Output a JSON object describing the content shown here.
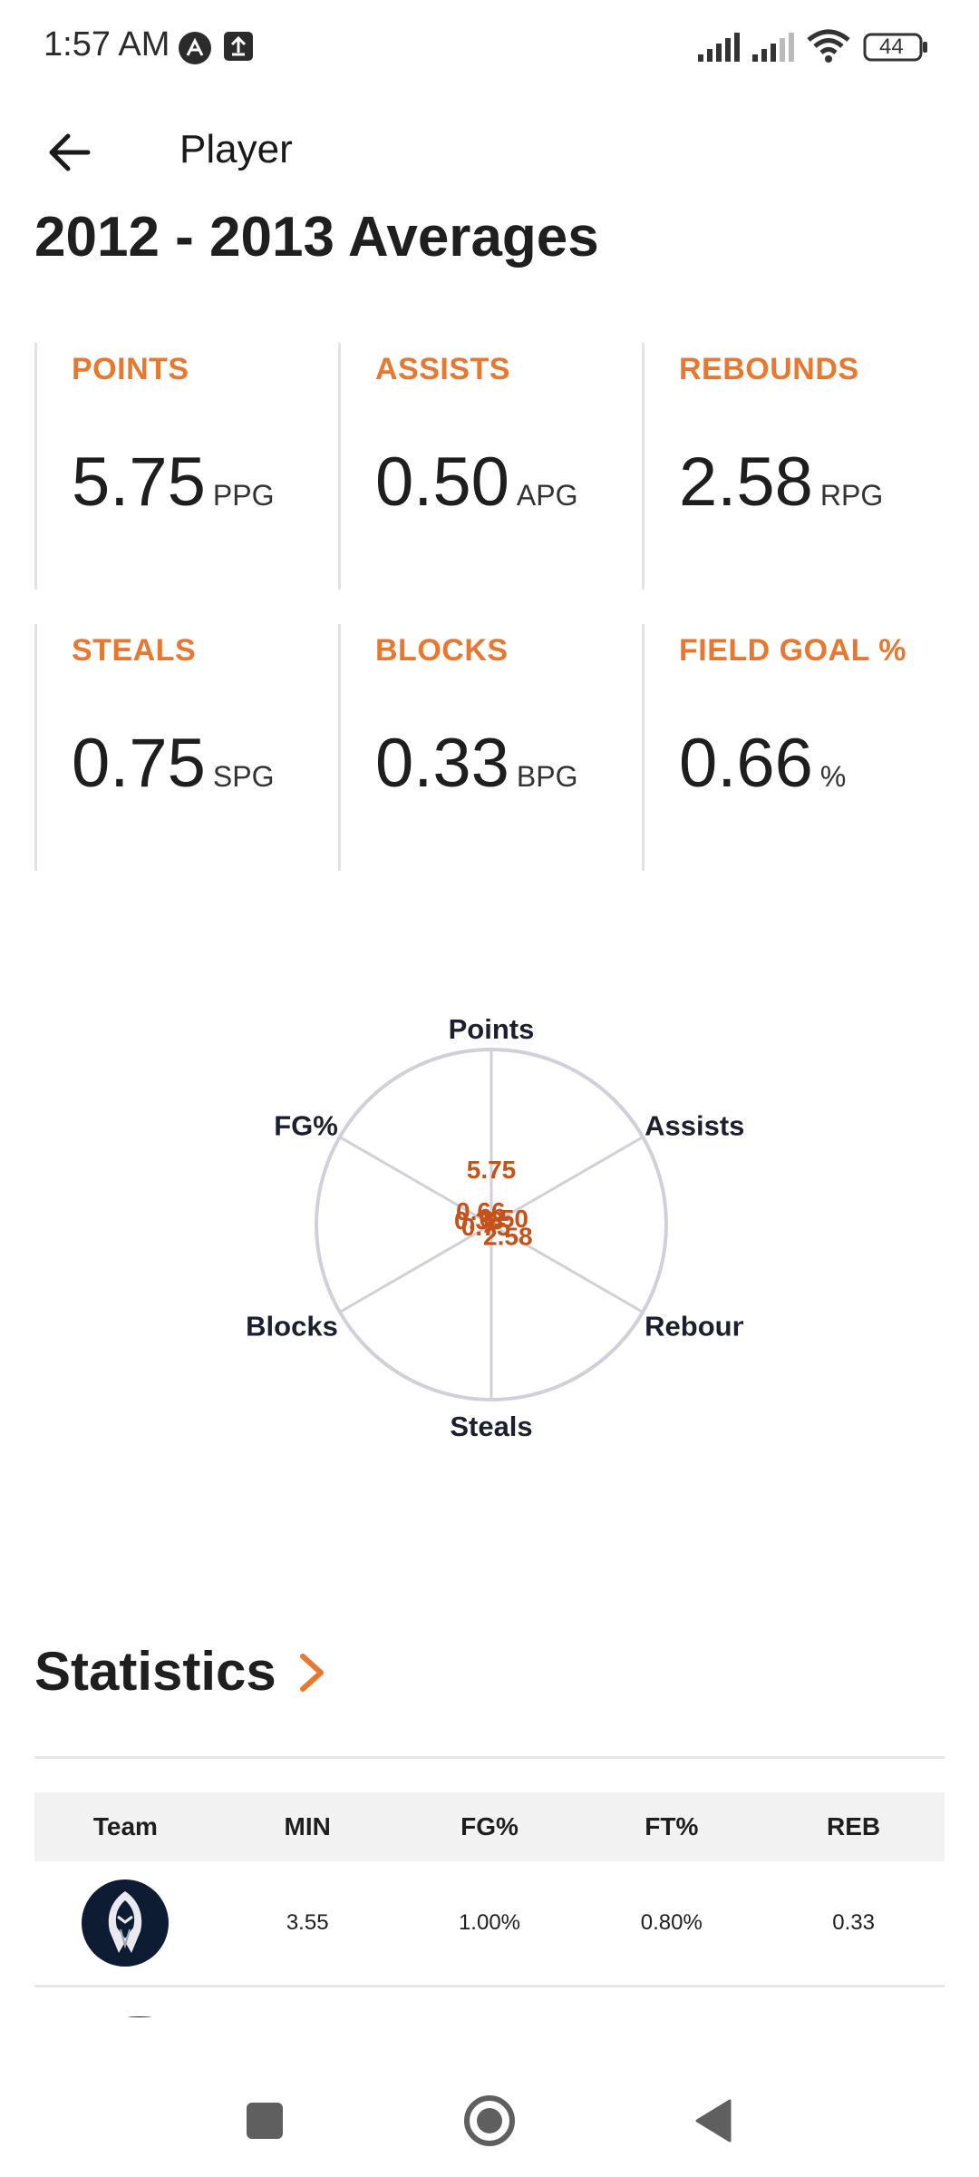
{
  "status_bar": {
    "time": "1:57 AM",
    "battery": "44",
    "icons": [
      "a-logo-icon",
      "upload-notification-icon",
      "signal-icon",
      "signal-icon",
      "wifi-icon",
      "battery-icon"
    ]
  },
  "appbar": {
    "title": "Player",
    "back_icon": "arrow-left-icon"
  },
  "page_title": "2012 - 2013 Averages",
  "accent_color": "#e8782f",
  "averages": [
    {
      "label": "POINTS",
      "value": "5.75",
      "unit": "PPG"
    },
    {
      "label": "ASSISTS",
      "value": "0.50",
      "unit": "APG"
    },
    {
      "label": "REBOUNDS",
      "value": "2.58",
      "unit": "RPG"
    },
    {
      "label": "STEALS",
      "value": "0.75",
      "unit": "SPG"
    },
    {
      "label": "BLOCKS",
      "value": "0.33",
      "unit": "BPG"
    },
    {
      "label": "FIELD GOAL %",
      "value": "0.66",
      "unit": "%"
    }
  ],
  "chart_data": {
    "type": "radar",
    "axes": [
      "Points",
      "Assists",
      "Rebounds",
      "Steals",
      "Blocks",
      "FG%"
    ],
    "axis_display_labels": [
      "Points",
      "Assists",
      "Reboun",
      "Steals",
      "Blocks",
      "FG%"
    ],
    "values": [
      5.75,
      0.5,
      2.58,
      0.75,
      0.33,
      0.66
    ],
    "value_labels": [
      "5.75",
      "0.50",
      "2.58",
      "0.75",
      "0.33",
      "0.66"
    ],
    "rmax": 100,
    "series_color": "#e8782f",
    "label_color": "#c4521a",
    "grid_color": "#d0d0d8"
  },
  "statistics": {
    "title": "Statistics",
    "columns": [
      "Team",
      "MIN",
      "FG%",
      "FT%",
      "REB"
    ],
    "rows": [
      {
        "team_icon": "team-logo-icon",
        "min": "3.55",
        "fg": "1.00%",
        "ft": "0.80%",
        "reb": "0.33"
      }
    ]
  },
  "nav_bar": {
    "icons": [
      "recents-square-icon",
      "home-circle-icon",
      "back-triangle-icon"
    ]
  }
}
